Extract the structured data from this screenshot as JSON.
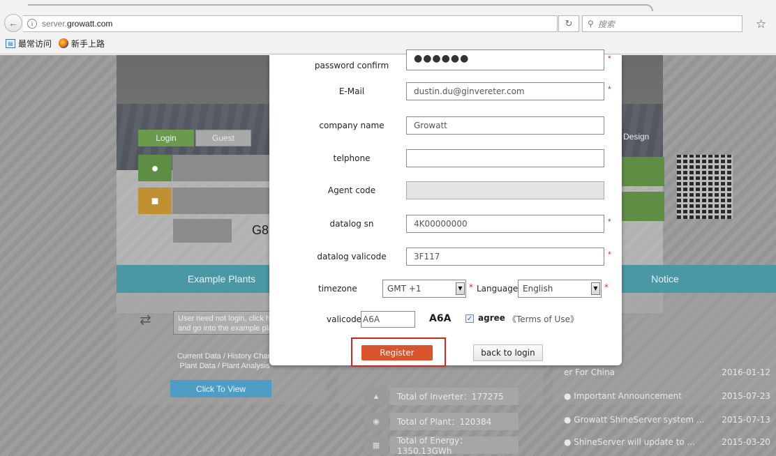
{
  "browser": {
    "url_host": "server.",
    "url_domain": "growatt.com",
    "search_placeholder": "搜索",
    "bookmarks": [
      "最常访问",
      "新手上路"
    ]
  },
  "background": {
    "login_tab": "Login",
    "guest_tab": "Guest",
    "design_text": "Design",
    "captcha_partial": "G8",
    "example_header": "Example Plants",
    "example_note": "User need not login, click here and go into the example plants.",
    "example_lines": [
      "Current Data / History Chart",
      "Plant Data / Plant Analysis"
    ],
    "click_to_view": "Click To View",
    "stats": [
      "Total of Inverter：177275",
      "Total of Plant：120384",
      "Total of Energy：1350.13GWh"
    ],
    "notice_header": "Notice",
    "notices": [
      {
        "title": "er For China",
        "date": "2016-01-12"
      },
      {
        "title": "● Important Announcement",
        "date": "2015-07-23"
      },
      {
        "title": "● Growatt ShineServer system ...",
        "date": "2015-07-13"
      },
      {
        "title": "● ShineServer will update to ...",
        "date": "2015-03-20"
      }
    ]
  },
  "form": {
    "password_confirm": {
      "label": "password confirm",
      "value": "●●●●●●"
    },
    "email": {
      "label": "E-Mail",
      "value": "dustin.du@ginvereter.com"
    },
    "company": {
      "label": "company name",
      "value": "Growatt"
    },
    "telphone": {
      "label": "telphone",
      "value": ""
    },
    "agent_code": {
      "label": "Agent code",
      "value": ""
    },
    "datalog_sn": {
      "label": "datalog sn",
      "value": "4K00000000"
    },
    "datalog_valicode": {
      "label": "datalog valicode",
      "value": "3F117"
    },
    "timezone": {
      "label": "timezone",
      "value": "GMT +1"
    },
    "language": {
      "label": "Language",
      "value": "English"
    },
    "valicode": {
      "label": "valicode",
      "value": "A6A",
      "code_image": "A6A"
    },
    "agree_label": "agree",
    "terms_link": "《Terms of Use》",
    "required_mark": "*",
    "register_label": "Register",
    "back_to_login_label": "back to login"
  }
}
